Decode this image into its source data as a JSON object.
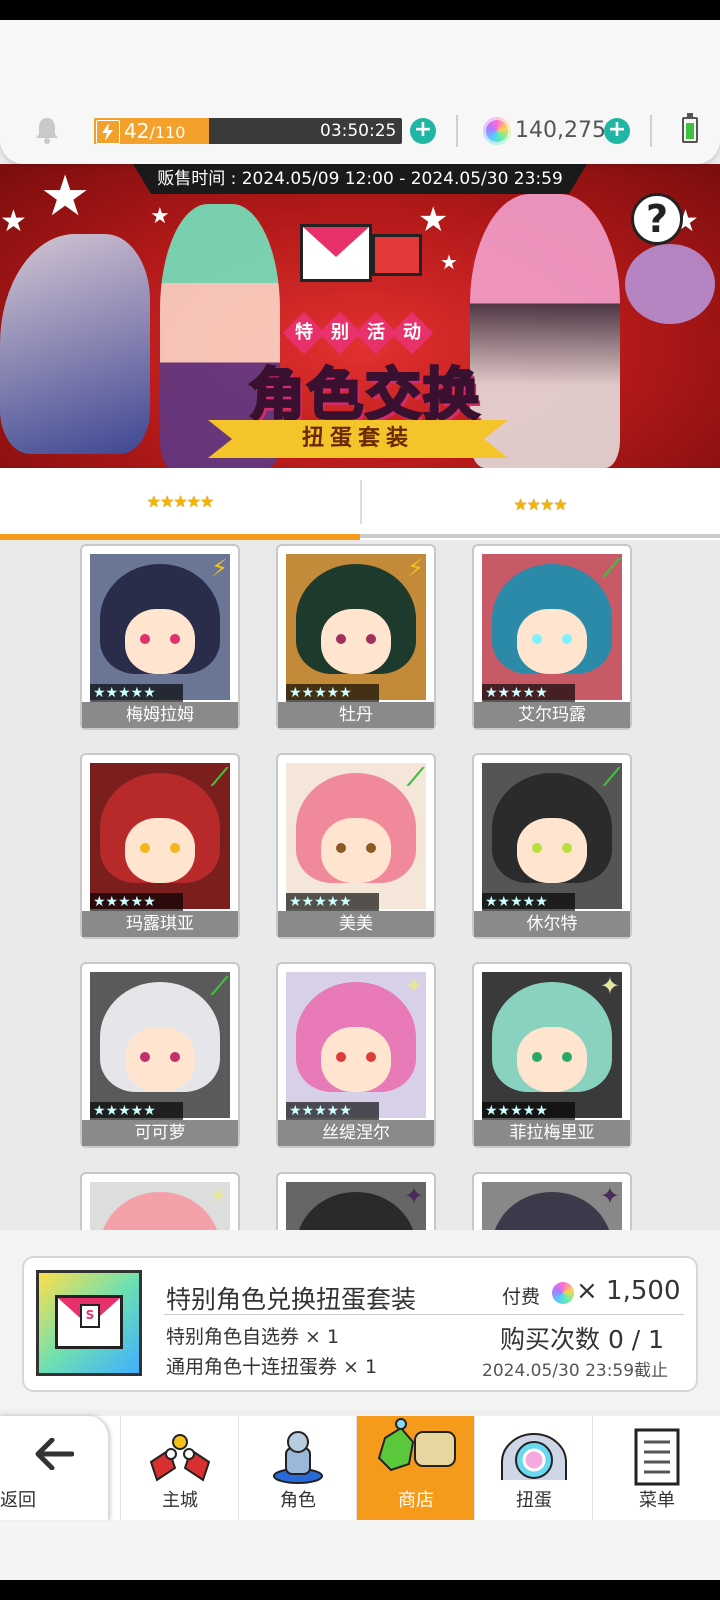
{
  "header": {
    "stamina_current": "42",
    "stamina_max": "/110",
    "stamina_fraction": 0.374,
    "timer": "03:50:25",
    "gems": "140,275",
    "plus": "+"
  },
  "banner": {
    "sale_period": "贩售时间 : 2024.05/09 12:00 - 2024.05/30 23:59",
    "tag_chars": [
      "特",
      "别",
      "活",
      "动"
    ],
    "title": "角色交换",
    "ribbon": "扭蛋套装",
    "help": "?"
  },
  "tabs": [
    {
      "stars": "★★★★★",
      "active": true
    },
    {
      "stars": "★★★★",
      "active": false
    }
  ],
  "characters": [
    {
      "name": "梅姆拉姆",
      "element": "⚡",
      "element_color": "#f5c21a",
      "hair": "#2a2d4a",
      "bg": "#6b7596",
      "eye": "#e0306a",
      "stars": "★★★★★"
    },
    {
      "name": "牡丹",
      "element": "⚡",
      "element_color": "#f5c21a",
      "hair": "#1d3a2c",
      "bg": "#c38a3a",
      "eye": "#a0305a",
      "stars": "★★★★★"
    },
    {
      "name": "艾尔玛露",
      "element": "⟋",
      "element_color": "#3ec23e",
      "hair": "#2b8aa8",
      "bg": "#c85a68",
      "eye": "#7ff0ff",
      "stars": "★★★★★"
    },
    {
      "name": "玛露琪亚",
      "element": "⟋",
      "element_color": "#3ec23e",
      "hair": "#b82a2a",
      "bg": "#7a1e1e",
      "eye": "#f2b81a",
      "stars": "★★★★★"
    },
    {
      "name": "美美",
      "element": "⟋",
      "element_color": "#3ec23e",
      "hair": "#f08a9a",
      "bg": "#f4e6d8",
      "eye": "#8a5a20",
      "stars": "★★★★★"
    },
    {
      "name": "休尔特",
      "element": "⟋",
      "element_color": "#3ec23e",
      "hair": "#2b2b2b",
      "bg": "#555",
      "eye": "#b8e03a",
      "stars": "★★★★★"
    },
    {
      "name": "可可萝",
      "element": "⟋",
      "element_color": "#3ec23e",
      "hair": "#e6e6ea",
      "bg": "#5a5a5a",
      "eye": "#c0306a",
      "stars": "★★★★★"
    },
    {
      "name": "丝缇涅尔",
      "element": "✦",
      "element_color": "#e6e6a0",
      "hair": "#e87ab8",
      "bg": "#d8d0e8",
      "eye": "#e03a3a",
      "stars": "★★★★★"
    },
    {
      "name": "菲拉梅里亚",
      "element": "✦",
      "element_color": "#e6e6a0",
      "hair": "#8ad2c0",
      "bg": "#3a3a3a",
      "eye": "#2aa86a",
      "stars": "★★★★★"
    },
    {
      "name": "",
      "element": "✦",
      "element_color": "#e6e6a0",
      "hair": "#f4a0a8",
      "bg": "#ddd",
      "eye": "#888",
      "stars": ""
    },
    {
      "name": "",
      "element": "✦",
      "element_color": "#4a2a5a",
      "hair": "#2a2a2a",
      "bg": "#666",
      "eye": "#888",
      "stars": ""
    },
    {
      "name": "",
      "element": "✦",
      "element_color": "#4a2a5a",
      "hair": "#3a3a4a",
      "bg": "#888",
      "eye": "#888",
      "stars": ""
    }
  ],
  "offer": {
    "title": "特别角色兑换扭蛋套装",
    "item1": "特别角色自选券 × 1",
    "item2": "通用角色十连扭蛋券 × 1",
    "paid_label": "付费",
    "price": "× 1,500",
    "purchase_count": "购买次数 0 / 1",
    "deadline": "2024.05/30 23:59截止",
    "badge": "S"
  },
  "nav": {
    "back": "返回",
    "items": [
      {
        "label": "主城",
        "icon": "castle-icon",
        "active": false
      },
      {
        "label": "角色",
        "icon": "character-icon",
        "active": false
      },
      {
        "label": "商店",
        "icon": "shop-icon",
        "active": true
      },
      {
        "label": "扭蛋",
        "icon": "gacha-icon",
        "active": false
      },
      {
        "label": "菜单",
        "icon": "menu-icon",
        "active": false
      }
    ]
  },
  "colors": {
    "accent_orange": "#f59a1a",
    "teal_plus": "#1fb6a4",
    "banner_red": "#c41e1e"
  }
}
